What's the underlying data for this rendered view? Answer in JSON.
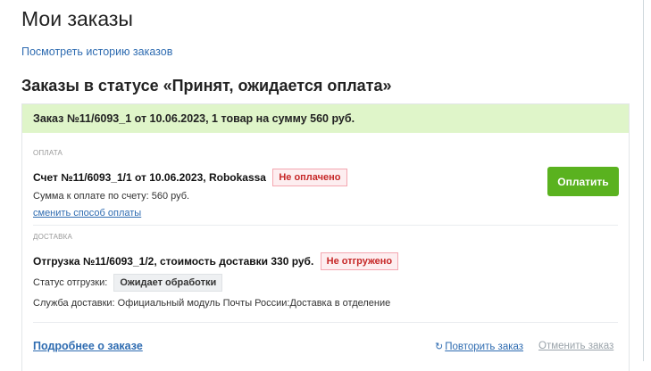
{
  "page": {
    "title": "Мои заказы",
    "history_link": "Посмотреть историю заказов",
    "section_title": "Заказы в статусе «Принят, ожидается оплата»"
  },
  "order": {
    "header": "Заказ №11/6093_1 от 10.06.2023, 1 товар на сумму 560 руб.",
    "payment": {
      "label": "ОПЛАТА",
      "invoice_title": "Счет №11/6093_1/1 от 10.06.2023, Robokassa",
      "status_badge": "Не оплачено",
      "amount_text": "Сумма к оплате по счету: 560 руб.",
      "change_method_link": "сменить способ оплаты",
      "pay_button": "Оплатить"
    },
    "delivery": {
      "label": "ДОСТАВКА",
      "shipment_title": "Отгрузка №11/6093_1/2, стоимость доставки 330 руб.",
      "status_badge": "Не отгружено",
      "shipment_status_label": "Статус отгрузки:",
      "shipment_status_value": "Ожидает обработки",
      "service_text": "Служба доставки: Официальный модуль Почты России:Доставка в отделение"
    },
    "footer": {
      "details_link": "Подробнее о заказе",
      "repeat_link": "Повторить заказ",
      "cancel_link": "Отменить заказ"
    }
  },
  "colors": {
    "accent_link": "#2f6cb1",
    "pay_button": "#5ab21f",
    "header_bg": "#dff5c9",
    "badge_red": "#c62828"
  },
  "icons": {
    "repeat": "refresh-icon"
  }
}
